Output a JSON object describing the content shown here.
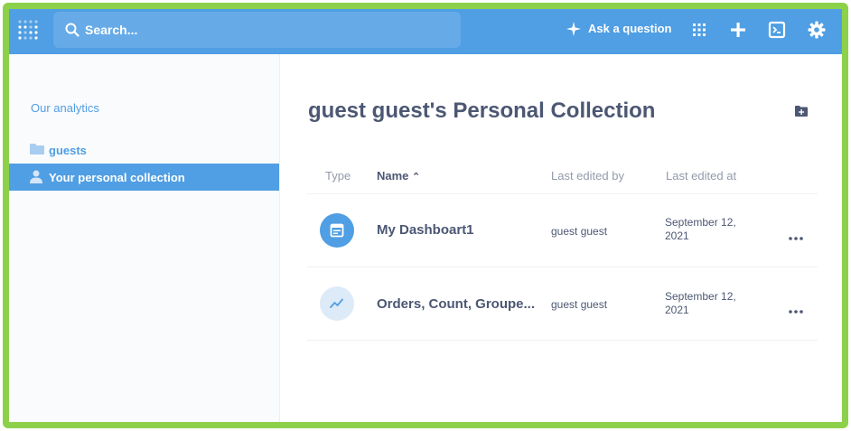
{
  "navbar": {
    "search_placeholder": "Search...",
    "ask_label": "Ask a question",
    "bg_color": "#509ee3",
    "icons": [
      "metabase-logo-icon",
      "search-icon",
      "sparkle-icon",
      "grid-icon",
      "plus-icon",
      "console-icon",
      "gear-icon"
    ]
  },
  "sidebar": {
    "root_label": "Our analytics",
    "items": [
      {
        "label": "guests",
        "icon": "folder-icon",
        "selected": false
      },
      {
        "label": "Your personal collection",
        "icon": "person-icon",
        "selected": true
      }
    ]
  },
  "main": {
    "title": "guest guest's Personal Collection",
    "columns": {
      "type": "Type",
      "name": "Name",
      "sort_indicator": "⌃",
      "last_edited_by": "Last edited by",
      "last_edited_at": "Last edited at"
    },
    "rows": [
      {
        "icon": "dashboard-icon",
        "name": "My Dashboart1",
        "by": "guest guest",
        "at": "September 12, 2021"
      },
      {
        "icon": "line-chart-icon",
        "name": "Orders, Count, Groupe...",
        "by": "guest guest",
        "at": "September 12, 2021"
      }
    ]
  },
  "colors": {
    "accent": "#509ee3",
    "text": "#4c5773",
    "muted": "#949aab",
    "frame": "#8dd14a"
  }
}
